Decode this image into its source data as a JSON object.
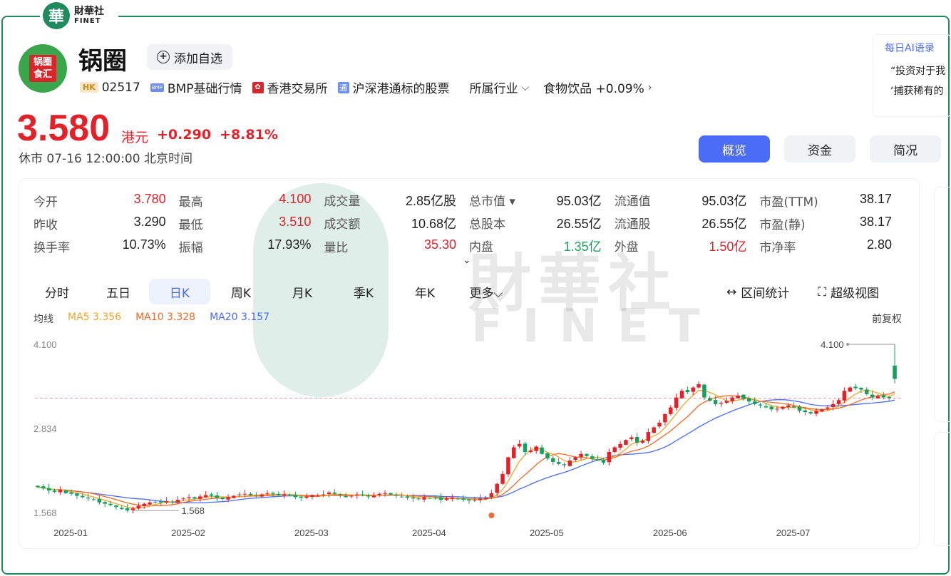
{
  "brand": {
    "seal": "華",
    "cn": "財華社",
    "en": "FINET"
  },
  "logo_text": "锅圈食汇",
  "stock": {
    "name": "锅圈",
    "watch_label": "添加自选"
  },
  "tags": {
    "hk_badge": "HK",
    "code": "02517",
    "bmp_badge": "BMP",
    "bmp": "BMP基础行情",
    "hkex": "香港交易所",
    "tong_badge": "通",
    "tong": "沪深港通标的股票",
    "industry_label": "所属行业",
    "industry": "食物饮品 +0.09%"
  },
  "ai": {
    "title": "每日AI语录",
    "line1": "“投资对于我",
    "line2": "‘捕获稀有的"
  },
  "quote": {
    "price": "3.580",
    "unit": "港元",
    "change": "+0.290",
    "pct": "+8.81%",
    "status": "休市 07-16 12:00:00 北京时间"
  },
  "tabs": [
    "概览",
    "资金",
    "简况"
  ],
  "stats": [
    [
      {
        "k": "今开",
        "v": "3.780",
        "c": "up"
      },
      {
        "k": "最高",
        "v": "4.100",
        "c": "up"
      },
      {
        "k": "成交量",
        "v": "2.85亿股",
        "c": ""
      },
      {
        "k": "总市值 ▾",
        "v": "95.03亿",
        "c": ""
      },
      {
        "k": "流通值",
        "v": "95.03亿",
        "c": ""
      },
      {
        "k": "市盈(TTM)",
        "v": "38.17",
        "c": ""
      }
    ],
    [
      {
        "k": "昨收",
        "v": "3.290",
        "c": ""
      },
      {
        "k": "最低",
        "v": "3.510",
        "c": "up"
      },
      {
        "k": "成交额",
        "v": "10.68亿",
        "c": ""
      },
      {
        "k": "总股本",
        "v": "26.55亿",
        "c": ""
      },
      {
        "k": "流通股",
        "v": "26.55亿",
        "c": ""
      },
      {
        "k": "市盈(静)",
        "v": "38.17",
        "c": ""
      }
    ],
    [
      {
        "k": "换手率",
        "v": "10.73%",
        "c": ""
      },
      {
        "k": "振幅",
        "v": "17.93%",
        "c": ""
      },
      {
        "k": "量比",
        "v": "35.30",
        "c": "up"
      },
      {
        "k": "内盘",
        "v": "1.35亿",
        "c": "down"
      },
      {
        "k": "外盘",
        "v": "1.50亿",
        "c": "up"
      },
      {
        "k": "市净率",
        "v": "2.80",
        "c": ""
      }
    ]
  ],
  "expand_icon": "⌄",
  "ktabs": [
    "分时",
    "五日",
    "日K",
    "周K",
    "月K",
    "季K",
    "年K",
    "更多"
  ],
  "tools": {
    "range": "区间统计",
    "super": "超级视图"
  },
  "ma": {
    "label": "均线",
    "ma5": "MA5 3.356",
    "ma10": "MA10 3.328",
    "ma20": "MA20 3.157",
    "adjust": "前复权"
  },
  "colors": {
    "up": "#e0232b",
    "down": "#17a05d",
    "ma5": "#f0a52c",
    "ma10": "#ef6a2a",
    "ma20": "#4a6cf7",
    "accent": "#4a6cf7"
  },
  "chart_data": {
    "type": "candlestick",
    "y_ticks": [
      "4.100",
      "2.834",
      "1.568"
    ],
    "ylim": [
      1.568,
      4.1
    ],
    "x_ticks": [
      "2025-01",
      "2025-02",
      "2025-03",
      "2025-04",
      "2025-05",
      "2025-06",
      "2025-07"
    ],
    "prev_close": 3.29,
    "max_label": "4.100",
    "min_label": "1.568",
    "series_close": [
      1.95,
      1.93,
      1.9,
      1.88,
      1.91,
      1.86,
      1.85,
      1.82,
      1.8,
      1.78,
      1.76,
      1.72,
      1.7,
      1.68,
      1.65,
      1.62,
      1.6,
      1.63,
      1.67,
      1.7,
      1.72,
      1.73,
      1.72,
      1.74,
      1.73,
      1.76,
      1.78,
      1.8,
      1.78,
      1.81,
      1.83,
      1.82,
      1.79,
      1.77,
      1.8,
      1.82,
      1.84,
      1.85,
      1.83,
      1.82,
      1.84,
      1.86,
      1.85,
      1.83,
      1.84,
      1.82,
      1.8,
      1.79,
      1.81,
      1.83,
      1.82,
      1.84,
      1.87,
      1.85,
      1.83,
      1.8,
      1.82,
      1.84,
      1.83,
      1.81,
      1.82,
      1.85,
      1.86,
      1.84,
      1.82,
      1.8,
      1.79,
      1.78,
      1.77,
      1.8,
      1.78,
      1.79,
      1.76,
      1.78,
      1.79,
      1.77,
      1.76,
      1.75,
      1.76,
      1.78,
      1.79,
      1.86,
      2.0,
      2.15,
      2.4,
      2.55,
      2.6,
      2.48,
      2.5,
      2.56,
      2.45,
      2.38,
      2.33,
      2.3,
      2.28,
      2.35,
      2.4,
      2.45,
      2.42,
      2.38,
      2.35,
      2.32,
      2.48,
      2.55,
      2.6,
      2.66,
      2.7,
      2.62,
      2.65,
      2.78,
      2.85,
      2.92,
      3.05,
      3.15,
      3.3,
      3.4,
      3.38,
      3.45,
      3.5,
      3.3,
      3.25,
      3.2,
      3.22,
      3.25,
      3.3,
      3.33,
      3.28,
      3.24,
      3.2,
      3.18,
      3.15,
      3.12,
      3.13,
      3.16,
      3.18,
      3.15,
      3.1,
      3.08,
      3.06,
      3.1,
      3.12,
      3.15,
      3.2,
      3.26,
      3.4,
      3.45,
      3.44,
      3.42,
      3.35,
      3.3,
      3.32,
      3.3,
      3.29,
      3.58
    ],
    "ma_values": {
      "ma5": 3.356,
      "ma10": 3.328,
      "ma20": 3.157
    }
  }
}
